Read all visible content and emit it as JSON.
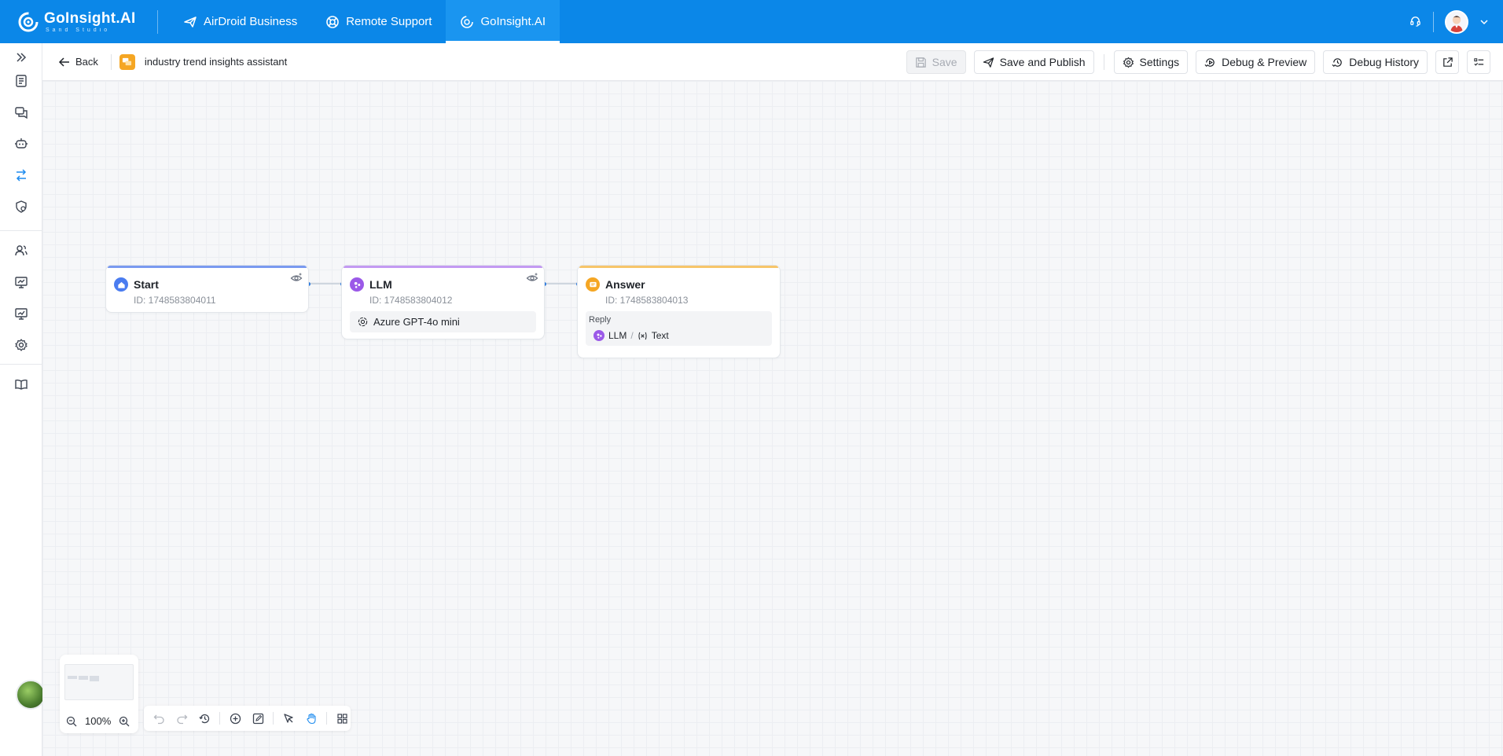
{
  "header": {
    "brand_title": "GoInsight.AI",
    "brand_sub": "Sand Studio",
    "nav": [
      {
        "label": "AirDroid Business",
        "icon": "paper-plane-icon"
      },
      {
        "label": "Remote Support",
        "icon": "lifebuoy-icon"
      },
      {
        "label": "GoInsight.AI",
        "icon": "goinsight-icon",
        "active": true
      }
    ]
  },
  "toolbar": {
    "back_label": "Back",
    "app_name": "industry trend insights assistant",
    "save_label": "Save",
    "save_publish_label": "Save and Publish",
    "settings_label": "Settings",
    "debug_preview_label": "Debug & Preview",
    "debug_history_label": "Debug History"
  },
  "nodes": {
    "start": {
      "title": "Start",
      "id_text": "ID: 1748583804011",
      "color": "#4a7cf0"
    },
    "llm": {
      "title": "LLM",
      "id_text": "ID: 1748583804012",
      "model": "Azure GPT-4o mini",
      "color": "#9b59e8"
    },
    "answer": {
      "title": "Answer",
      "id_text": "ID: 1748583804013",
      "reply_label": "Reply",
      "reply_source": "LLM",
      "reply_var": "Text",
      "color": "#f5a623"
    }
  },
  "canvas_controls": {
    "zoom": "100%"
  },
  "colors": {
    "header_bg": "#0b87e8",
    "accent": "#1f8cef"
  }
}
